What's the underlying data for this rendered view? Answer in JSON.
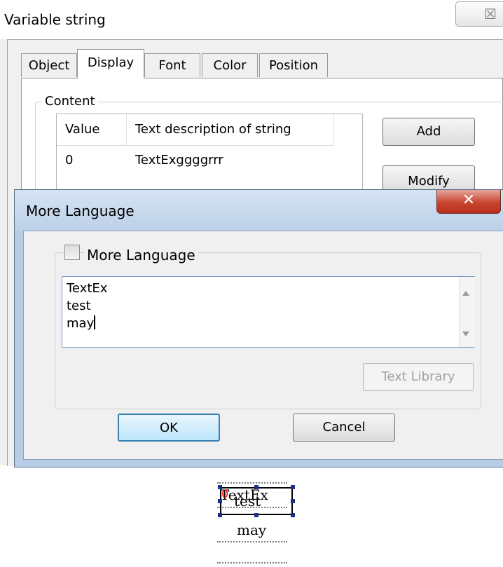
{
  "back_dialog": {
    "title": "Variable string",
    "close_glyph": "☒",
    "tabs": [
      {
        "label": "Object",
        "active": false
      },
      {
        "label": "Display",
        "active": true
      },
      {
        "label": "Font",
        "active": false
      },
      {
        "label": "Color",
        "active": false
      },
      {
        "label": "Position",
        "active": false
      }
    ],
    "content_label": "Content",
    "table": {
      "headers": [
        "Value",
        "Text description of string"
      ],
      "rows": [
        [
          "0",
          "TextExggggrrr"
        ]
      ]
    },
    "buttons": {
      "add": "Add",
      "modify": "Modify"
    }
  },
  "more_language_dialog": {
    "title": "More Language",
    "close_glyph": "✕",
    "group_checkbox_label": "More Language",
    "group_checked": false,
    "text_lines": [
      "TextEx",
      "test",
      "may"
    ],
    "text_library_button": "Text Library",
    "ok_button": "OK",
    "cancel_button": "Cancel"
  },
  "preview": {
    "index_label": "0",
    "top_text": "TextEx",
    "middle_text": "test",
    "bottom_text": "may",
    "index_color": "#ff0000"
  }
}
